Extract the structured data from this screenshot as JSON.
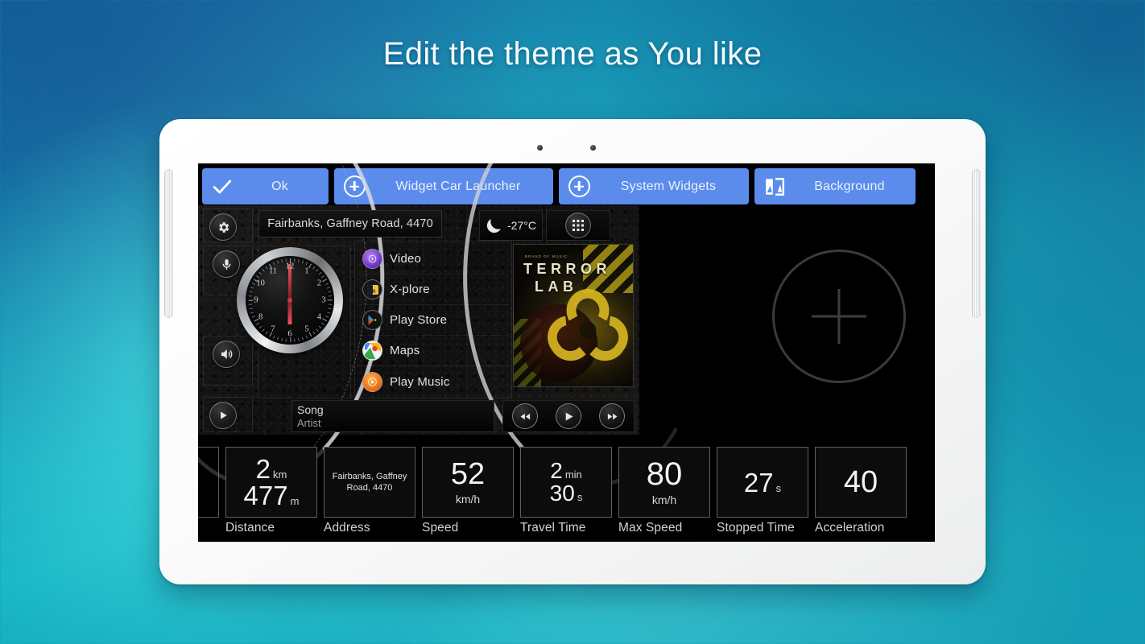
{
  "headline": "Edit the theme as You like",
  "toolbar": {
    "buttons": [
      {
        "label": "Ok",
        "icon": "check-icon"
      },
      {
        "label": "Widget Car Launcher",
        "icon": "plus-circle-icon"
      },
      {
        "label": "System Widgets",
        "icon": "plus-circle-icon"
      },
      {
        "label": "Background",
        "icon": "background-image-icon"
      }
    ],
    "accent_color": "#5b8ceb",
    "text_color": "#e9f0ff"
  },
  "launcher": {
    "address": "Fairbanks, Gaffney Road, 4470",
    "weather": {
      "icon": "moon-icon",
      "temperature": "-27°C"
    },
    "apps_grid_icon": "apps-grid-icon",
    "settings_icon": "gear-icon",
    "mic_icon": "microphone-icon",
    "volume_icon": "speaker-icon",
    "media_toggle_icon": "play-circle-icon",
    "clock": {
      "numbers": [
        "12",
        "1",
        "2",
        "3",
        "4",
        "5",
        "6",
        "7",
        "8",
        "9",
        "10",
        "11"
      ],
      "hour_hand_deg": 180,
      "minute_hand_deg": 0
    },
    "apps": [
      {
        "label": "Video",
        "icon": "video-icon"
      },
      {
        "label": "X-plore",
        "icon": "xplore-icon"
      },
      {
        "label": "Play Store",
        "icon": "play-store-icon"
      },
      {
        "label": "Maps",
        "icon": "maps-icon"
      },
      {
        "label": "Play Music",
        "icon": "play-music-icon"
      }
    ],
    "album": {
      "brand": "BRAND OF MUSIC",
      "title_line1": "TERROR",
      "title_line2": "LAB",
      "artwork_icon": "biohazard-icon"
    },
    "media": {
      "song": "Song",
      "artist": "Artist",
      "prev_icon": "rewind-icon",
      "play_icon": "play-icon",
      "next_icon": "fast-forward-icon"
    },
    "add_widget_icon": "plus-large-icon"
  },
  "stats": [
    {
      "caption": "Distance",
      "value_top": "2",
      "unit_top": "km",
      "value_bottom": "477",
      "unit_bottom": "m",
      "kind": "two-line"
    },
    {
      "caption": "Address",
      "text": "Fairbanks, Gaffney Road, 4470",
      "kind": "address"
    },
    {
      "caption": "Speed",
      "value_top": "52",
      "unit_top": "",
      "sub": "km/h",
      "kind": "value-sub"
    },
    {
      "caption": "Travel Time",
      "value_top": "2",
      "unit_top": "min",
      "value_bottom": "30",
      "unit_bottom": "s",
      "kind": "two-line"
    },
    {
      "caption": "Max Speed",
      "value_top": "80",
      "unit_top": "",
      "sub": "km/h",
      "kind": "value-sub"
    },
    {
      "caption": "Stopped Time",
      "value_top": "27",
      "unit_top": "s",
      "kind": "one-line"
    },
    {
      "caption": "Acceleration",
      "value_top": "40",
      "unit_top": "",
      "kind": "one-line"
    }
  ]
}
